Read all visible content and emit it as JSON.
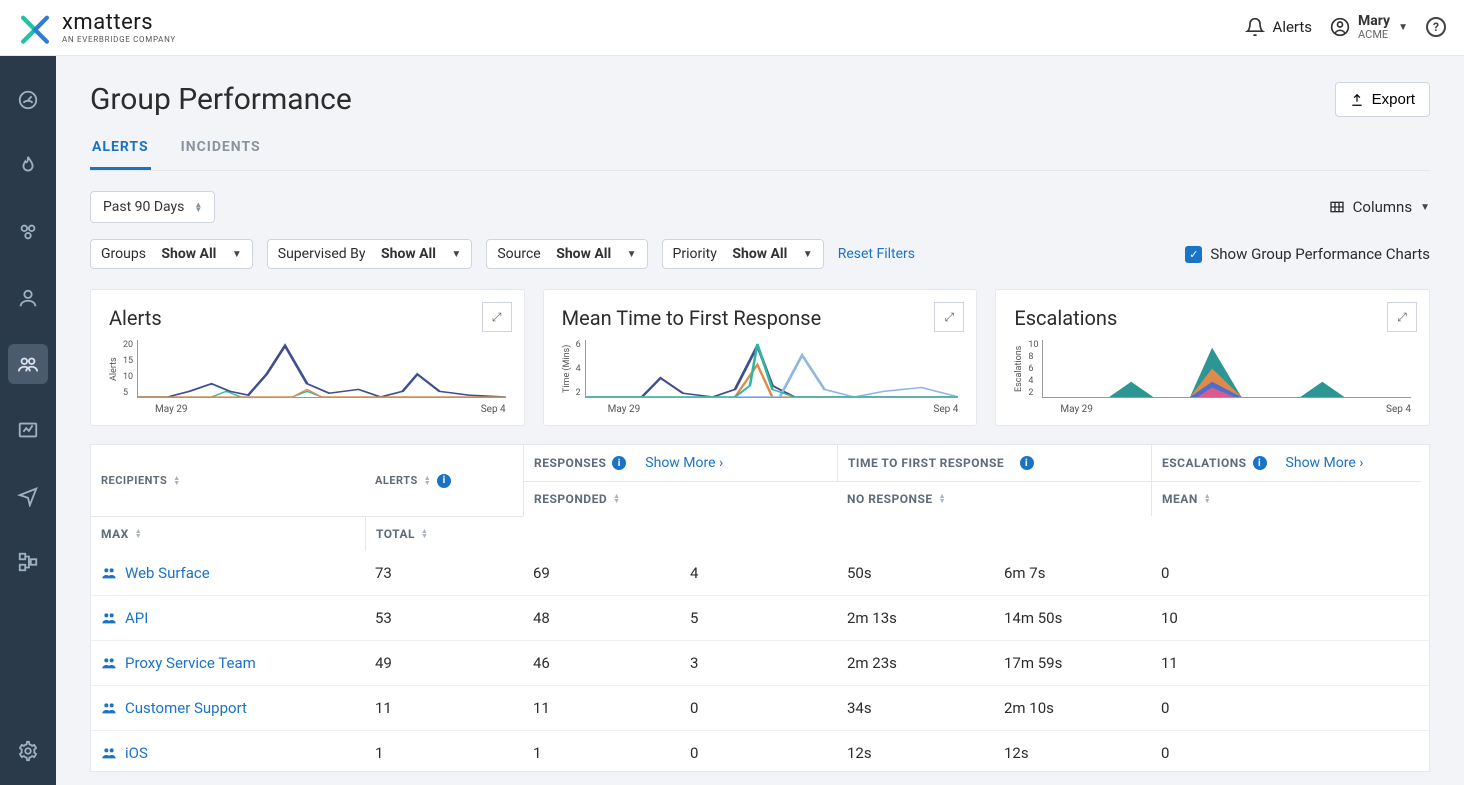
{
  "brand": {
    "name": "xmatters",
    "tagline": "AN EVERBRIDGE COMPANY"
  },
  "top": {
    "alerts": "Alerts",
    "user_name": "Mary",
    "user_org": "ACME"
  },
  "page_title": "Group Performance",
  "export": "Export",
  "tabs": {
    "alerts": "ALERTS",
    "incidents": "INCIDENTS"
  },
  "toolbar": {
    "range": "Past 90 Days",
    "columns": "Columns"
  },
  "filters": {
    "groups_label": "Groups",
    "groups_val": "Show All",
    "supervised_label": "Supervised By",
    "supervised_val": "Show All",
    "source_label": "Source",
    "source_val": "Show All",
    "priority_label": "Priority",
    "priority_val": "Show All",
    "reset": "Reset Filters",
    "show_charts": "Show Group Performance Charts"
  },
  "cards": {
    "alerts_title": "Alerts",
    "alerts_ylabel": "Alerts",
    "mttr_title": "Mean Time to First Response",
    "mttr_ylabel": "Time (Mins)",
    "esc_title": "Escalations",
    "esc_ylabel": "Escalations"
  },
  "xaxis_start": "May 29",
  "xaxis_end": "Sep 4",
  "yticks_alerts": [
    "20",
    "15",
    "10",
    "5"
  ],
  "yticks_mttr": [
    "6",
    "4",
    "2"
  ],
  "yticks_esc": [
    "10",
    "8",
    "6",
    "4",
    "2"
  ],
  "table": {
    "recipients": "RECIPIENTS",
    "alerts": "ALERTS",
    "responses": "RESPONSES",
    "ttfr": "TIME TO FIRST RESPONSE",
    "escalations": "ESCALATIONS",
    "showmore": "Show More",
    "responded": "RESPONDED",
    "noresponse": "NO RESPONSE",
    "mean": "MEAN",
    "max": "MAX",
    "total": "TOTAL",
    "rows": [
      {
        "r": "Web Surface",
        "a": "73",
        "resp": "69",
        "nr": "4",
        "mean": "50s",
        "max": "6m 7s",
        "total": "0"
      },
      {
        "r": "API",
        "a": "53",
        "resp": "48",
        "nr": "5",
        "mean": "2m 13s",
        "max": "14m 50s",
        "total": "10"
      },
      {
        "r": "Proxy Service Team",
        "a": "49",
        "resp": "46",
        "nr": "3",
        "mean": "2m 23s",
        "max": "17m 59s",
        "total": "11"
      },
      {
        "r": "Customer Support",
        "a": "11",
        "resp": "11",
        "nr": "0",
        "mean": "34s",
        "max": "2m 10s",
        "total": "0"
      },
      {
        "r": "iOS",
        "a": "1",
        "resp": "1",
        "nr": "0",
        "mean": "12s",
        "max": "12s",
        "total": "0"
      }
    ]
  },
  "chart_data": [
    {
      "type": "line",
      "title": "Alerts",
      "ylabel": "Alerts",
      "ylim": [
        0,
        20
      ],
      "x_range": [
        "May 29",
        "Sep 4"
      ],
      "note": "multi-series sparkline; values estimated from pixels",
      "series": [
        {
          "name": "primary",
          "values": [
            0,
            0,
            2,
            4,
            2,
            1,
            0,
            10,
            22,
            8,
            2,
            1,
            3,
            0,
            2,
            8,
            3,
            0,
            1,
            0
          ]
        }
      ]
    },
    {
      "type": "line",
      "title": "Mean Time to First Response",
      "ylabel": "Time (Mins)",
      "ylim": [
        0,
        6
      ],
      "x_range": [
        "May 29",
        "Sep 4"
      ],
      "series": [
        {
          "name": "teal",
          "values": [
            0,
            0,
            0,
            0,
            0.5,
            2,
            1,
            0,
            0,
            1,
            6,
            2,
            0,
            0,
            0,
            0,
            0,
            0,
            0,
            0
          ]
        },
        {
          "name": "orange",
          "values": [
            0,
            0,
            0,
            0,
            0,
            0,
            0,
            0,
            0,
            1,
            3,
            1,
            0,
            0,
            0,
            0,
            0,
            0,
            0,
            0
          ]
        },
        {
          "name": "lightblue",
          "values": [
            0,
            0,
            0,
            0,
            0,
            0,
            0,
            0,
            0,
            0,
            0,
            0,
            4,
            1,
            0,
            0,
            0.5,
            0.3,
            1,
            0
          ]
        }
      ]
    },
    {
      "type": "area",
      "title": "Escalations",
      "ylabel": "Escalations",
      "ylim": [
        0,
        10
      ],
      "x_range": [
        "May 29",
        "Sep 4"
      ],
      "series": [
        {
          "name": "teal",
          "values": [
            0,
            0,
            0,
            2,
            3,
            0,
            0,
            0,
            5,
            10,
            4,
            0,
            0,
            0,
            0,
            0,
            3,
            1,
            0,
            0
          ]
        },
        {
          "name": "orange",
          "values": [
            0,
            0,
            0,
            0,
            0,
            0,
            0,
            0,
            2,
            5,
            2,
            0,
            0,
            0,
            0,
            0,
            0,
            0,
            0,
            0
          ]
        },
        {
          "name": "blue",
          "values": [
            0,
            0,
            0,
            0,
            0,
            0,
            0,
            0,
            1,
            3,
            1,
            0,
            0,
            0,
            0,
            0,
            0,
            0,
            0,
            0
          ]
        }
      ]
    }
  ]
}
